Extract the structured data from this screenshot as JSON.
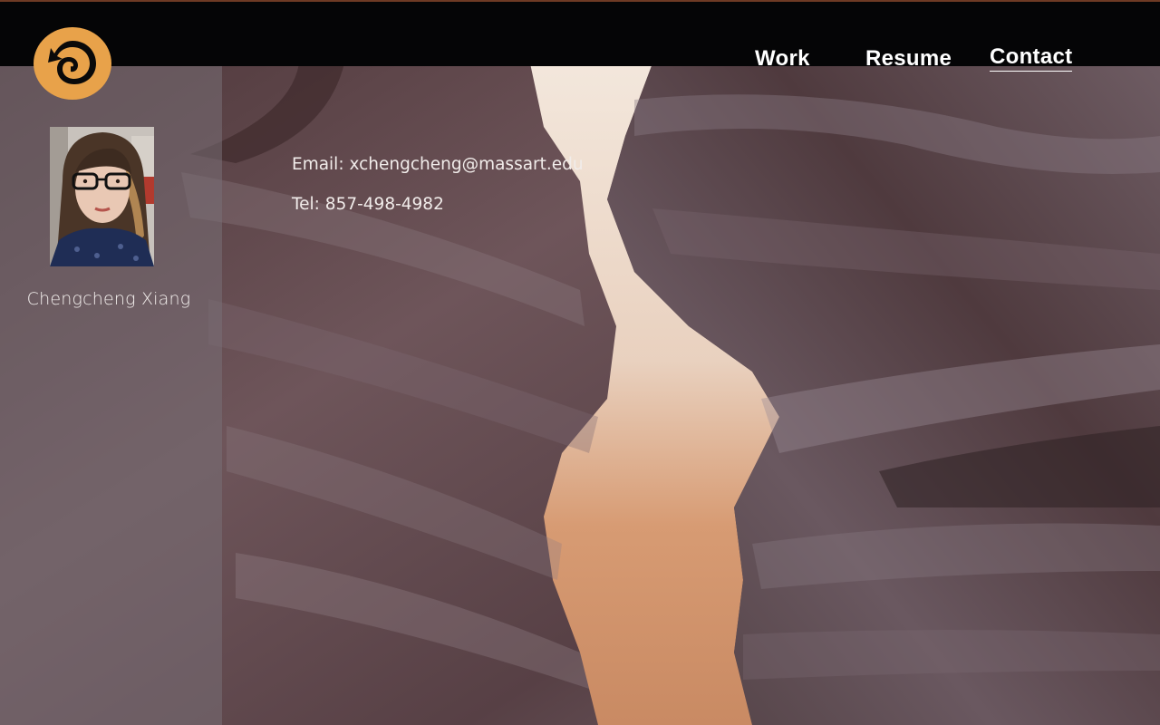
{
  "colors": {
    "topbar": "#050506",
    "logo_orange": "#e8a24a",
    "nav_text": "#ffffff",
    "sidebar_overlay": "rgba(120,112,118,0.55)"
  },
  "header": {
    "logo_icon": "swirl-arrow-logo-icon",
    "nav": [
      {
        "label": "Work",
        "active": false
      },
      {
        "label": "Resume",
        "active": false
      },
      {
        "label": "Contact",
        "active": true
      }
    ]
  },
  "sidebar": {
    "avatar_icon": "profile-photo",
    "name": "Chengcheng Xiang"
  },
  "contact": {
    "email_label": "Email: ",
    "email_value": "xchengcheng@massart.edu",
    "tel_label": "Tel: ",
    "tel_value": "857-498-4982"
  }
}
